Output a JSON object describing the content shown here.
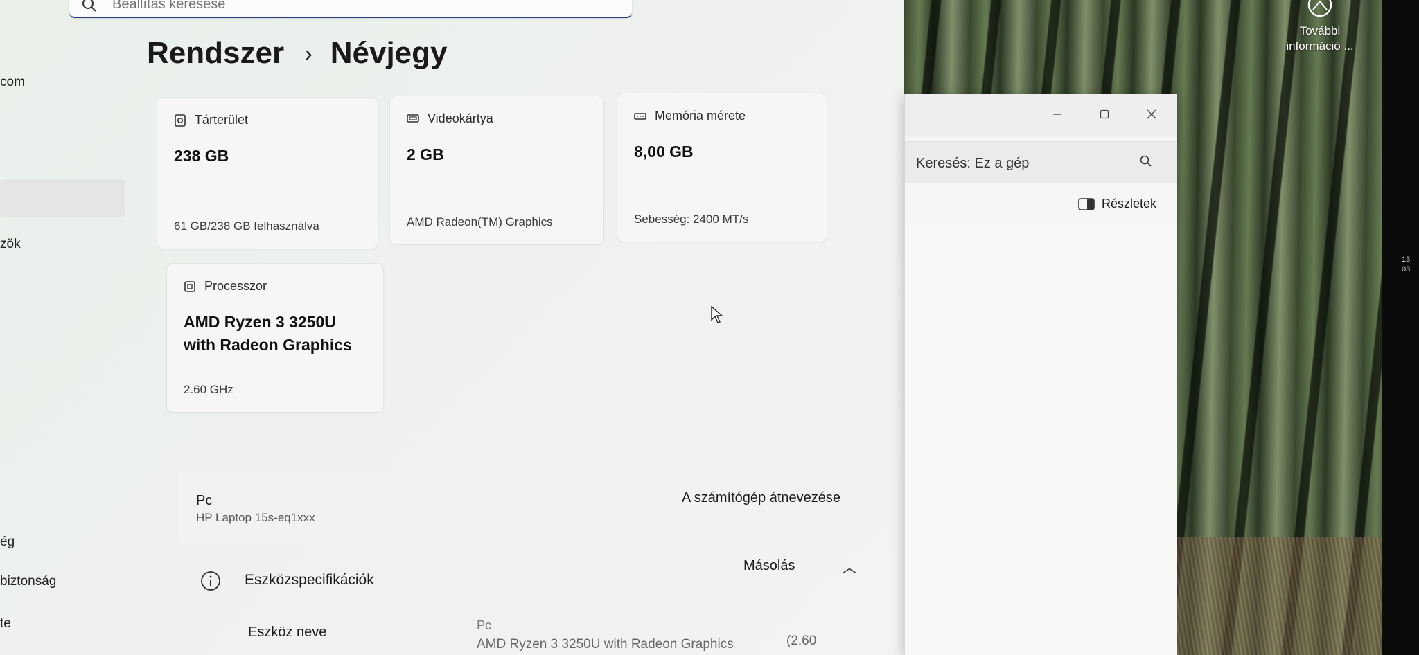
{
  "settings": {
    "search_placeholder": "Beállítás keresése",
    "sidebar_fragments": [
      "com",
      "zök",
      "ég",
      "biztonság",
      "te"
    ],
    "breadcrumb": {
      "parent": "Rendszer",
      "separator": "›",
      "current": "Névjegy"
    },
    "cards": {
      "storage": {
        "label": "Tárterület",
        "value": "238 GB",
        "detail": "61 GB/238 GB felhasználva"
      },
      "gpu": {
        "label": "Videokártya",
        "value": "2 GB",
        "detail": "AMD Radeon(TM) Graphics"
      },
      "memory": {
        "label": "Memória mérete",
        "value": "8,00 GB",
        "detail": "Sebesség: 2400 MT/s"
      },
      "cpu": {
        "label": "Processzor",
        "value_line1": "AMD Ryzen 3 3250U",
        "value_line2": "with Radeon Graphics",
        "detail": "2.60 GHz"
      }
    },
    "pc_row": {
      "title": "Pc",
      "subtitle": "HP Laptop 15s-eq1xxx",
      "rename_button": "A számítógép átnevezése"
    },
    "specs": {
      "title": "Eszközspecifikációk",
      "copy_button": "Másolás",
      "device_name_label": "Eszköz neve",
      "device_name_value": "Pc",
      "processor_value": "AMD Ryzen 3 3250U with Radeon Graphics",
      "processor_suffix": "(2.60"
    }
  },
  "desktop": {
    "info_widget": {
      "line1": "További",
      "line2": "információ ..."
    },
    "bezel_fragments": [
      "13",
      "03."
    ]
  },
  "explorer": {
    "search_placeholder": "Keresés: Ez a gép",
    "details_button": "Részletek"
  },
  "colors": {
    "accent": "#2b3a8c",
    "settings_bg": "#eef1ee"
  }
}
